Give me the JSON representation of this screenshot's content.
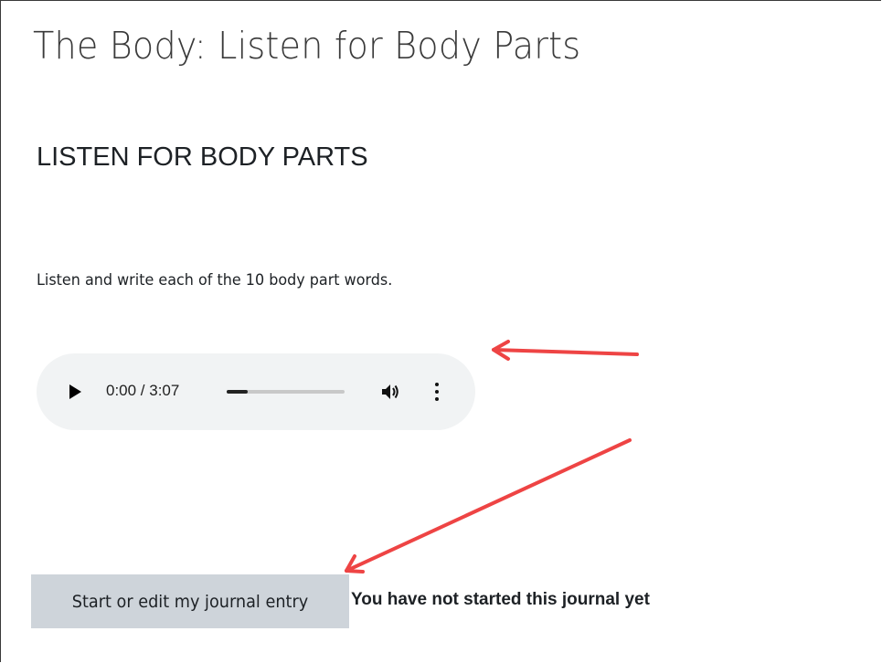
{
  "page": {
    "title": "The Body: Listen for Body Parts",
    "section_heading": "LISTEN FOR BODY PARTS",
    "instructions": "Listen and write each of the 10 body part words."
  },
  "audio_player": {
    "time_display": "0:00 / 3:07",
    "progress": 0.18,
    "icons": [
      "play-icon",
      "volume-icon",
      "more-options-icon"
    ]
  },
  "journal": {
    "button_label": "Start or edit my journal entry",
    "status_text": "You have not started this journal yet"
  },
  "annotations": {
    "arrow_color": "#ee4444"
  }
}
